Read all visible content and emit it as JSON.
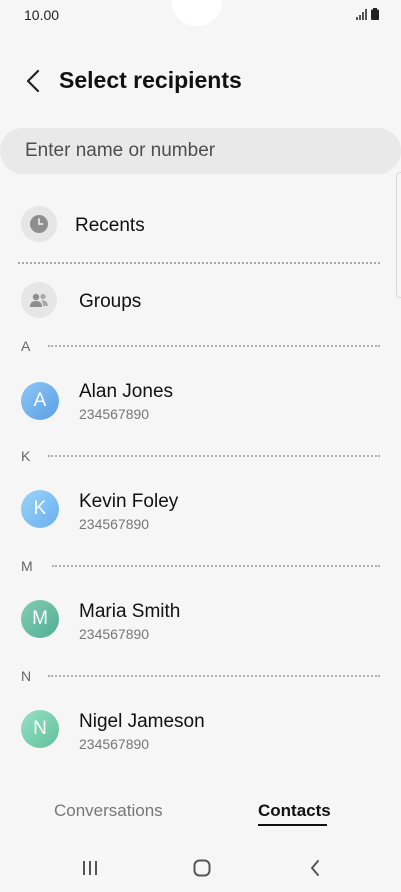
{
  "status_bar": {
    "time": "10.00"
  },
  "header": {
    "title": "Select recipients"
  },
  "search": {
    "placeholder": "Enter name or number"
  },
  "shortcuts": {
    "recents_label": "Recents",
    "groups_label": "Groups"
  },
  "sections": [
    {
      "letter": "A",
      "contact": {
        "initial": "A",
        "name": "Alan Jones",
        "number": "234567890",
        "color": "#6fb1ec"
      }
    },
    {
      "letter": "K",
      "contact": {
        "initial": "K",
        "name": "Kevin Foley",
        "number": "234567890",
        "color": "#7fc4f0"
      }
    },
    {
      "letter": "M",
      "contact": {
        "initial": "M",
        "name": "Maria Smith",
        "number": "234567890",
        "color": "#6cbfa4"
      }
    },
    {
      "letter": "N",
      "contact": {
        "initial": "N",
        "name": "Nigel Jameson",
        "number": "234567890",
        "color": "#7fd0b4"
      }
    }
  ],
  "tabs": {
    "conversations_label": "Conversations",
    "contacts_label": "Contacts",
    "active": "Contacts"
  },
  "icons": {
    "recents": "clock-icon",
    "groups": "people-icon",
    "back": "chevron-left-icon",
    "nav_recents": "recent-apps-icon",
    "nav_home": "home-icon",
    "nav_back": "nav-back-icon"
  }
}
